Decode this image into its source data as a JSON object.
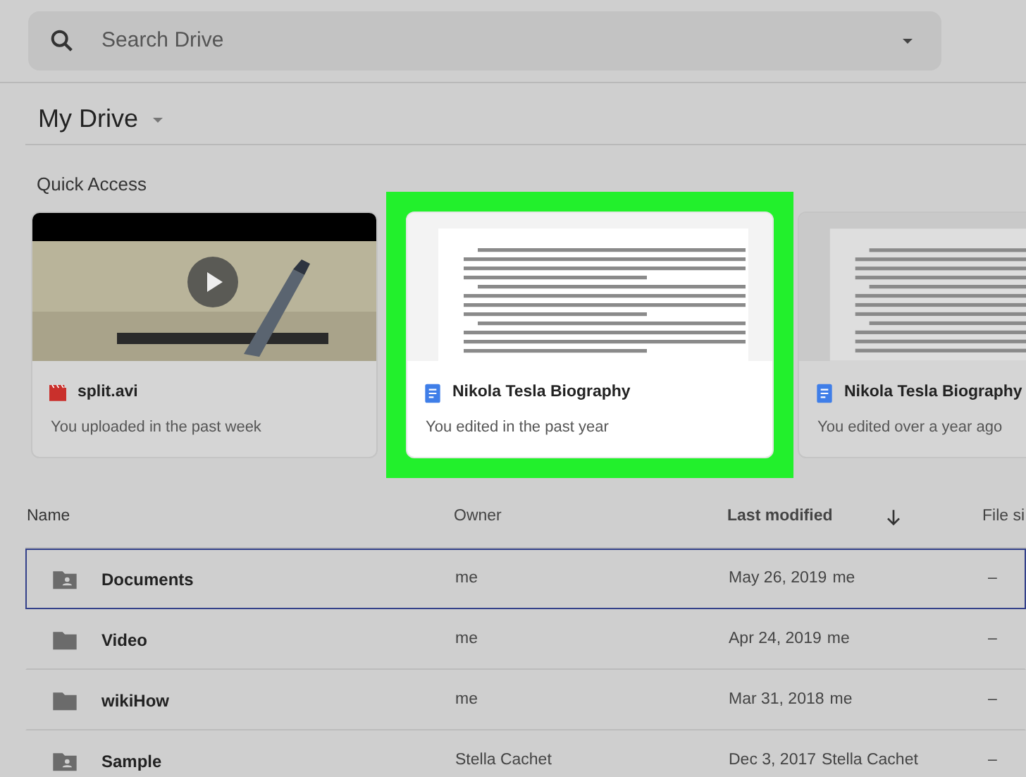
{
  "search": {
    "placeholder": "Search Drive"
  },
  "location": {
    "title": "My Drive"
  },
  "quick_access": {
    "title": "Quick Access",
    "cards": [
      {
        "kind": "video",
        "name": "split.avi",
        "activity": "You uploaded in the past week",
        "highlighted": false
      },
      {
        "kind": "document",
        "name": "Nikola Tesla Biography",
        "activity": "You edited in the past year",
        "highlighted": true
      },
      {
        "kind": "document",
        "name": "Nikola Tesla Biography",
        "activity": "You edited over a year ago",
        "highlighted": false
      }
    ]
  },
  "table": {
    "columns": [
      "Name",
      "Owner",
      "Last modified",
      "File si"
    ],
    "rows": [
      {
        "kind": "shared-folder",
        "name": "Documents",
        "owner": "me",
        "modified": "May 26, 2019",
        "modified_by": "me",
        "size": "–",
        "selected": true
      },
      {
        "kind": "folder",
        "name": "Video",
        "owner": "me",
        "modified": "Apr 24, 2019",
        "modified_by": "me",
        "size": "–",
        "selected": false
      },
      {
        "kind": "folder",
        "name": "wikiHow",
        "owner": "me",
        "modified": "Mar 31, 2018",
        "modified_by": "me",
        "size": "–",
        "selected": false
      },
      {
        "kind": "shared-folder",
        "name": "Sample",
        "owner": "Stella Cachet",
        "modified": "Dec 3, 2017",
        "modified_by": "Stella Cachet",
        "size": "–",
        "selected": false
      }
    ]
  }
}
